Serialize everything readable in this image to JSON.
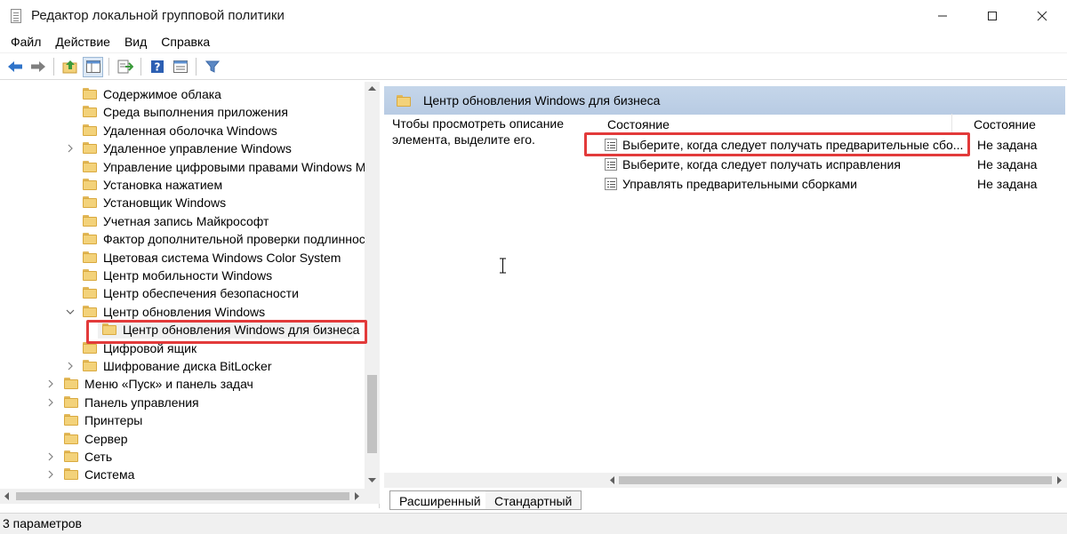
{
  "window": {
    "title": "Редактор локальной групповой политики",
    "icon": "policy-editor-icon"
  },
  "menu": [
    "Файл",
    "Действие",
    "Вид",
    "Справка"
  ],
  "toolbar": {
    "icons": [
      "back-arrow-icon",
      "forward-arrow-icon",
      "up-folder-icon",
      "show-hide-tree-icon",
      "export-list-icon",
      "help-icon",
      "properties-icon",
      "filter-icon"
    ]
  },
  "tree": {
    "items": [
      {
        "label": "Содержимое облака",
        "expandable": false,
        "level": 2
      },
      {
        "label": "Среда выполнения приложения",
        "expandable": false,
        "level": 2
      },
      {
        "label": "Удаленная оболочка Windows",
        "expandable": false,
        "level": 2
      },
      {
        "label": "Удаленное управление Windows",
        "expandable": true,
        "level": 2
      },
      {
        "label": "Управление цифровыми правами Windows Me",
        "expandable": false,
        "level": 2
      },
      {
        "label": "Установка нажатием",
        "expandable": false,
        "level": 2
      },
      {
        "label": "Установщик Windows",
        "expandable": false,
        "level": 2
      },
      {
        "label": "Учетная запись Майкрософт",
        "expandable": false,
        "level": 2
      },
      {
        "label": "Фактор дополнительной проверки подлинност",
        "expandable": false,
        "level": 2
      },
      {
        "label": "Цветовая система Windows Color System",
        "expandable": false,
        "level": 2
      },
      {
        "label": "Центр мобильности Windows",
        "expandable": false,
        "level": 2
      },
      {
        "label": "Центр обеспечения безопасности",
        "expandable": false,
        "level": 2
      },
      {
        "label": "Центр обновления Windows",
        "expandable": true,
        "expanded": true,
        "level": 2
      },
      {
        "label": "Центр обновления Windows для бизнеса",
        "expandable": false,
        "level": 3,
        "selected": true
      },
      {
        "label": "Цифровой ящик",
        "expandable": false,
        "level": 2
      },
      {
        "label": "Шифрование диска BitLocker",
        "expandable": true,
        "level": 2
      },
      {
        "label": "Меню «Пуск» и панель задач",
        "expandable": true,
        "level": 1
      },
      {
        "label": "Панель управления",
        "expandable": true,
        "level": 1
      },
      {
        "label": "Принтеры",
        "expandable": false,
        "level": 1
      },
      {
        "label": "Сервер",
        "expandable": false,
        "level": 1
      },
      {
        "label": "Сеть",
        "expandable": true,
        "level": 1
      },
      {
        "label": "Система",
        "expandable": true,
        "level": 1
      }
    ]
  },
  "details": {
    "header": "Центр обновления Windows для бизнеса",
    "description": "Чтобы просмотреть описание элемента, выделите его.",
    "columns": {
      "setting": "Состояние",
      "state": "Состояние"
    },
    "rows": [
      {
        "name": "Выберите, когда следует получать предварительные сбо...",
        "state": "Не задана"
      },
      {
        "name": "Выберите, когда следует получать исправления",
        "state": "Не задана"
      },
      {
        "name": "Управлять предварительными сборками",
        "state": "Не задана"
      }
    ]
  },
  "tabs": [
    "Расширенный",
    "Стандартный"
  ],
  "status": "3 параметров",
  "colors": {
    "highlight": "#e23a3a",
    "header_bg": "#c5d6ea",
    "folder": "#f3d27a"
  }
}
